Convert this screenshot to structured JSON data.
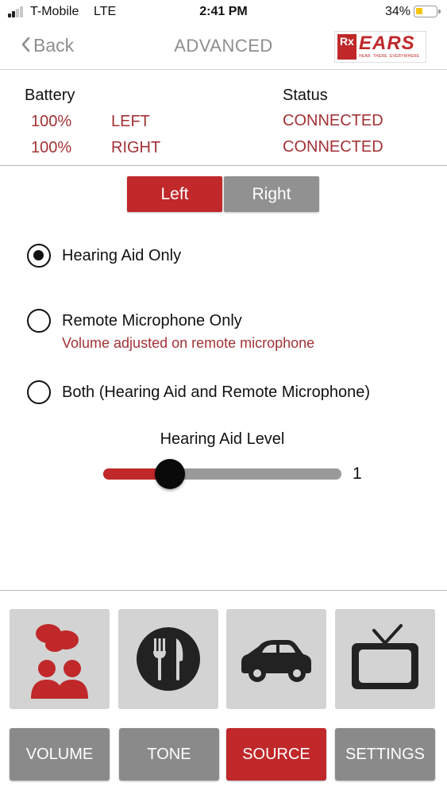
{
  "status_bar": {
    "carrier": "T-Mobile",
    "network": "LTE",
    "time": "2:41 PM",
    "battery_percent": "34%",
    "battery_level": 0.34
  },
  "nav": {
    "back_label": "Back",
    "title": "ADVANCED",
    "logo": {
      "rx": "Rx",
      "brand": "EARS",
      "tagline": "HEAR. THERE. EVERYWHERE"
    }
  },
  "info": {
    "battery_header": "Battery",
    "status_header": "Status",
    "rows": [
      {
        "battery": "100%",
        "side": "LEFT",
        "status": "CONNECTED"
      },
      {
        "battery": "100%",
        "side": "RIGHT",
        "status": "CONNECTED"
      }
    ]
  },
  "segments": {
    "left": "Left",
    "right": "Right",
    "selected": "left"
  },
  "options": [
    {
      "label": "Hearing Aid Only",
      "checked": true,
      "sub": ""
    },
    {
      "label": "Remote Microphone Only",
      "checked": false,
      "sub": "Volume adjusted on remote microphone"
    },
    {
      "label": "Both (Hearing Aid and Remote Microphone)",
      "checked": false,
      "sub": ""
    }
  ],
  "slider": {
    "title": "Hearing Aid Level",
    "value": "1",
    "fraction": 0.28
  },
  "tiles": [
    {
      "icon": "people-talking-icon"
    },
    {
      "icon": "fork-knife-icon"
    },
    {
      "icon": "car-icon"
    },
    {
      "icon": "tv-icon"
    }
  ],
  "tabs": [
    {
      "label": "VOLUME",
      "active": false
    },
    {
      "label": "TONE",
      "active": false
    },
    {
      "label": "SOURCE",
      "active": true
    },
    {
      "label": "SETTINGS",
      "active": false
    }
  ],
  "colors": {
    "accent": "#c0282a",
    "inactive": "#8a8a8a",
    "text_red": "#a33236"
  }
}
